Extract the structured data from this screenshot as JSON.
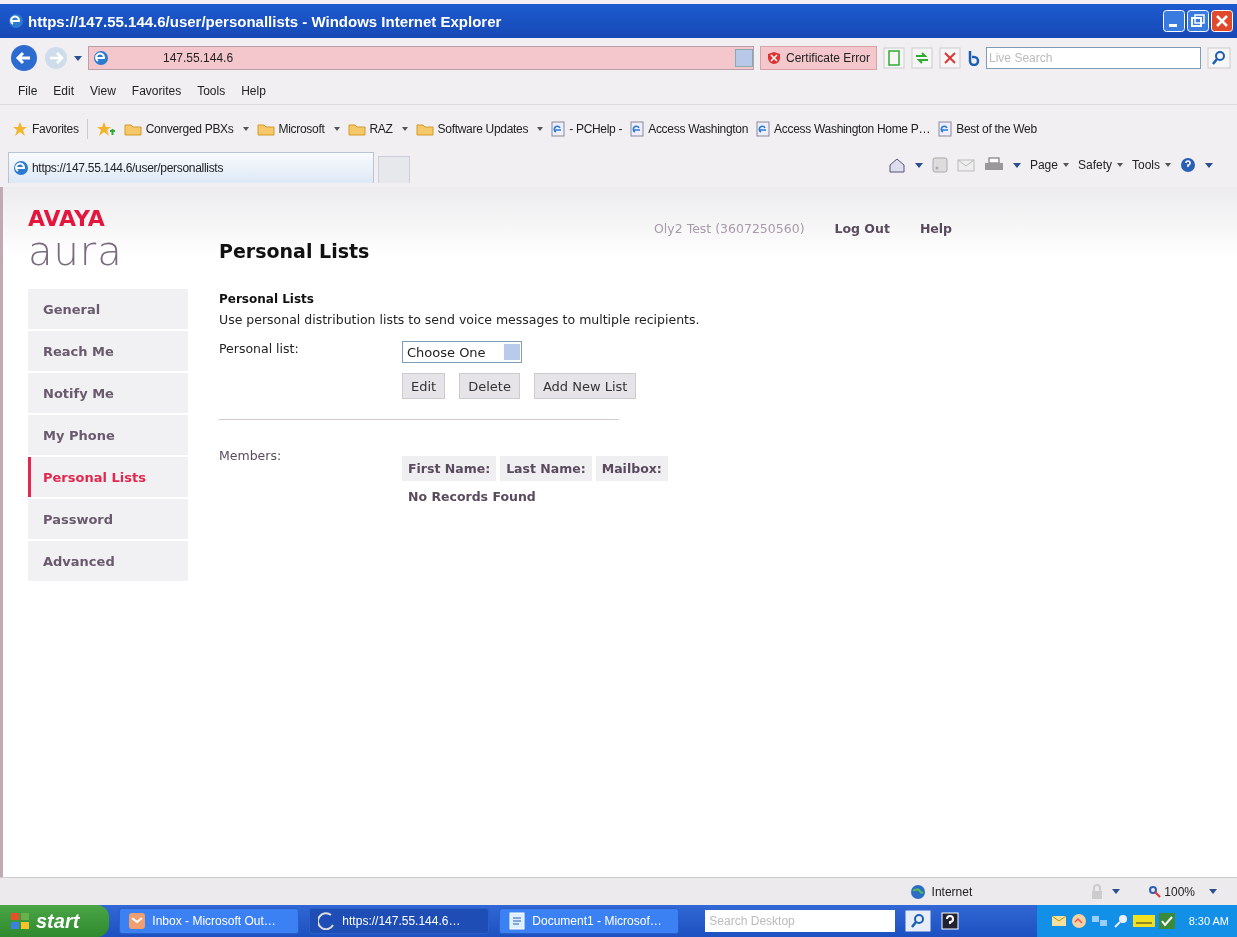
{
  "window": {
    "title": "https://147.55.144.6/user/personallists - Windows Internet Explorer"
  },
  "address": {
    "url": "147.55.144.6",
    "certificate_error": "Certificate Error"
  },
  "search": {
    "placeholder": "Live Search"
  },
  "menu": [
    "File",
    "Edit",
    "View",
    "Favorites",
    "Tools",
    "Help"
  ],
  "favorites_bar": {
    "label": "Favorites",
    "items": [
      {
        "label": "Converged PBXs",
        "kind": "folder",
        "dropdown": true
      },
      {
        "label": "Microsoft",
        "kind": "folder",
        "dropdown": true
      },
      {
        "label": "RAZ",
        "kind": "folder",
        "dropdown": true
      },
      {
        "label": "Software Updates",
        "kind": "folder",
        "dropdown": true
      },
      {
        "label": "- PCHelp -",
        "kind": "page",
        "dropdown": false
      },
      {
        "label": "Access Washington",
        "kind": "page",
        "dropdown": false
      },
      {
        "label": "Access Washington Home P…",
        "kind": "page",
        "dropdown": false
      },
      {
        "label": "Best of the Web",
        "kind": "page",
        "dropdown": false
      }
    ]
  },
  "tab": {
    "title": "https://147.55.144.6/user/personallists"
  },
  "command_bar": [
    {
      "kind": "home"
    },
    {
      "kind": "feeds"
    },
    {
      "kind": "mail"
    },
    {
      "kind": "print"
    },
    {
      "kind": "menu",
      "label": "Page"
    },
    {
      "kind": "menu",
      "label": "Safety"
    },
    {
      "kind": "menu",
      "label": "Tools"
    },
    {
      "kind": "help"
    }
  ],
  "page": {
    "logo": {
      "brand": "AVAYA",
      "product": "aura"
    },
    "user": "Oly2 Test (3607250560)",
    "header_links": [
      "Log Out",
      "Help"
    ],
    "title": "Personal Lists",
    "sidebar": [
      {
        "label": "General",
        "selected": false
      },
      {
        "label": "Reach Me",
        "selected": false
      },
      {
        "label": "Notify Me",
        "selected": false
      },
      {
        "label": "My Phone",
        "selected": false
      },
      {
        "label": "Personal Lists",
        "selected": true
      },
      {
        "label": "Password",
        "selected": false
      },
      {
        "label": "Advanced",
        "selected": false
      }
    ],
    "section_heading": "Personal Lists",
    "description": "Use personal distribution lists to send voice messages to multiple recipients.",
    "list_label": "Personal list:",
    "list_select": {
      "value": "Choose One"
    },
    "buttons": [
      "Edit",
      "Delete",
      "Add New List"
    ],
    "members_label": "Members:",
    "columns": [
      "First Name:",
      "Last Name:",
      "Mailbox:"
    ],
    "empty_message": "No Records Found"
  },
  "status_bar": {
    "zone": "Internet",
    "zoom": "100%"
  },
  "taskbar": {
    "start": "start",
    "tasks": [
      {
        "label": "Inbox - Microsoft Out…",
        "kind": "mail",
        "selected": false
      },
      {
        "label": "https://147.55.144.6…",
        "kind": "browser",
        "selected": true
      },
      {
        "label": "Document1 - Microsof…",
        "kind": "document",
        "selected": false
      }
    ],
    "search_placeholder": "Search Desktop",
    "clock": "8:30 AM"
  }
}
